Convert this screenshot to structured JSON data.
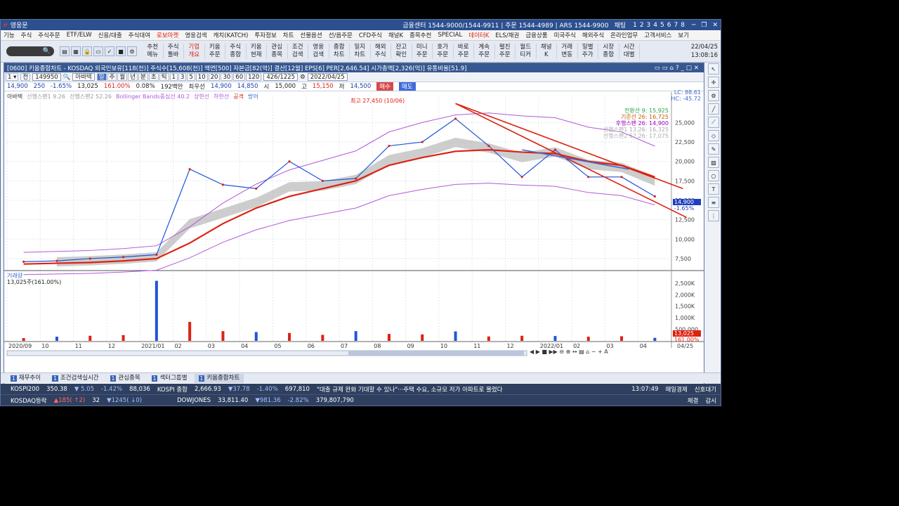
{
  "app": {
    "title": "영웅문",
    "center_info": "금융센터 1544-9000/1544-9911 | 주문 1544-4989 | ARS 1544-9900",
    "chat_label": "채팅",
    "screen_nums": [
      "1",
      "2",
      "3",
      "4",
      "5",
      "6",
      "7",
      "8"
    ]
  },
  "menu": [
    "기능",
    "주식",
    "주식주문",
    "ETF/ELW",
    "신용/대출",
    "주식대여",
    "로보마켓",
    "영웅검색",
    "캐치(KATCH)",
    "투자정보",
    "차트",
    "선물옵션",
    "선/옵주문",
    "CFD주식",
    "채널K",
    "종목추천",
    "SPECIAL",
    "데이터K",
    "ELS/채권",
    "금융상품",
    "미국주식",
    "해외주식",
    "온라인업무",
    "고객서비스",
    "보기"
  ],
  "menu_highlight": [
    "로보마켓",
    "데이터K"
  ],
  "toolbar": {
    "search_icon": "search-icon",
    "buttons": [
      "추천 메뉴",
      "주식 툴바",
      "기업 개요",
      "키움 주문",
      "주식 종합",
      "키움 현재",
      "관심 종목",
      "조건 검색",
      "영웅 검색",
      "종합 차트",
      "일지 차트",
      "해외 주식",
      "잔고 확인",
      "미니 주문",
      "호가 주문",
      "바로 주문",
      "계속 주문",
      "펼친 주문",
      "월드 티커",
      "채널 K",
      "거래 변동",
      "일별 주가",
      "시장 종합",
      "시간 대별"
    ],
    "highlight": [
      "기업 개요"
    ],
    "date": "22/04/25",
    "time": "13:08:16"
  },
  "chart_window": {
    "title": "[0600] 키움종합차트 - KOSDAQ 외국인보유[118(천)] 주식수[15,608(천)] 액면[500] 자본금[82(억)] 결산[12월] EPS[6] PER[2,646.54] 시가총액[2,326(억)] 유통비율[51.9]",
    "code": "149950",
    "stock_name": "아바텍",
    "periods": [
      "일",
      "주",
      "월",
      "년",
      "분",
      "초",
      "틱",
      "1",
      "3",
      "5",
      "10",
      "20",
      "30",
      "60",
      "120"
    ],
    "active_period": "일",
    "count": "426/1225",
    "date": "2022/04/25",
    "quote": {
      "price": "14,900",
      "change": "250",
      "rate": "-1.65%",
      "volume": "13,025",
      "volume_rate": "161.00%",
      "turnover": "0.08%",
      "amount": "192백만",
      "best_ask_label": "최우선",
      "best_ask": "14,900",
      "best_bid": "14,850",
      "open_label": "시",
      "open": "15,000",
      "high_label": "고",
      "high": "15,150",
      "low_label": "저",
      "low": "14,500",
      "buy": "매수",
      "sell": "매도"
    },
    "legend_top": [
      "아바텍",
      "선행스팬1 9.26",
      "선행스팬2 52.26",
      "Bollinger Bands중심선 40.2",
      "상한선",
      "하한선",
      "공격",
      "방어"
    ],
    "ichimoku_legend": [
      "전환선 9: 15,925",
      "기준선 26: 16,725",
      "후행스팬 26: 14,900",
      "선행스팬1 13.26: 16,325",
      "선행스팬2 52.26: 17,075"
    ],
    "lc_hc": [
      "LC: 88.61",
      "HC: -45.72"
    ],
    "high_marker": "최고 27,450 (10/06)",
    "price_badge": {
      "price": "14,900",
      "rate": "-1.65%"
    },
    "volume_label": "거래량",
    "volume_value": "13,025주(161.00%)",
    "volume_badge": {
      "value": "13,025",
      "rate": "161.00%"
    },
    "x_labels": [
      "2020/09",
      "10",
      "11",
      "12",
      "2021/01",
      "02",
      "03",
      "04",
      "05",
      "06",
      "07",
      "08",
      "09",
      "10",
      "11",
      "12",
      "2022/01",
      "02",
      "03",
      "04"
    ],
    "price_ticks": [
      "25,000",
      "22,500",
      "20,000",
      "17,500",
      "15,000",
      "12,500",
      "10,000",
      "7,500"
    ],
    "volume_ticks": [
      "2,500K",
      "2,000K",
      "1,500K",
      "1,000K",
      "500,000"
    ],
    "last_date": "04/25"
  },
  "chart_data": {
    "type": "line",
    "title": "아바텍",
    "y_range": [
      6500,
      28200
    ],
    "x": [
      "2020/09",
      "10",
      "11",
      "12",
      "2021/01",
      "02",
      "03",
      "04",
      "05",
      "06",
      "07",
      "08",
      "09",
      "10",
      "11",
      "12",
      "2022/01",
      "02",
      "03",
      "04"
    ],
    "series": [
      {
        "name": "아바텍",
        "values": [
          7100,
          7200,
          7500,
          7700,
          8000,
          19000,
          17000,
          16500,
          20000,
          17500,
          17800,
          22000,
          22500,
          25500,
          22000,
          18000,
          21500,
          18000,
          18000,
          15500
        ]
      },
      {
        "name": "Bollinger Bands중심선 40.2",
        "values": [
          6800,
          6900,
          7000,
          7200,
          7500,
          9500,
          12000,
          14000,
          15500,
          16500,
          17500,
          19500,
          20500,
          21300,
          21500,
          21200,
          21000,
          20000,
          19500,
          18000
        ]
      }
    ],
    "volume_series": {
      "name": "거래량",
      "unit": "주",
      "values": [
        120000,
        180000,
        220000,
        250000,
        2600000,
        820000,
        420000,
        380000,
        340000,
        260000,
        420000,
        300000,
        280000,
        410000,
        190000,
        220000,
        210000,
        180000,
        200000,
        130000
      ]
    }
  },
  "tabs": [
    {
      "n": "1",
      "label": "재무추이"
    },
    {
      "n": "1",
      "label": "조건검색실시간"
    },
    {
      "n": "1",
      "label": "관심종목"
    },
    {
      "n": "1",
      "label": "섹터그룹별"
    },
    {
      "n": "1",
      "label": "키움종합차트"
    }
  ],
  "ticker": {
    "row1": {
      "idx": "KOSPI200",
      "val": "350.38",
      "chg": "▼ 5.05",
      "rate": "-1.42%",
      "vol": "88,036",
      "idx2": "KOSPI 종합",
      "val2": "2,666.93",
      "chg2": "▼37.78",
      "rate2": "-1.40%",
      "vol2": "697,810",
      "news": "\"대출 규제 완화 기대할 수 있나\"···주택 수요, 소규모 저가 아파트로 몰렸다",
      "time": "13:07:49",
      "source": "매일경제",
      "signal": "신호대기"
    },
    "row2": {
      "idx": "KOSDAQ등락",
      "a": "▲185( ↑2)",
      "b": "32",
      "c": "▼1245( ↓0)",
      "idx2": "DOWJONES",
      "val2": "33,811.40",
      "chg2": "▼981.36",
      "rate2": "-2.82%",
      "vol2": "379,807,790",
      "btn1": "체결",
      "btn2": "감시"
    }
  }
}
